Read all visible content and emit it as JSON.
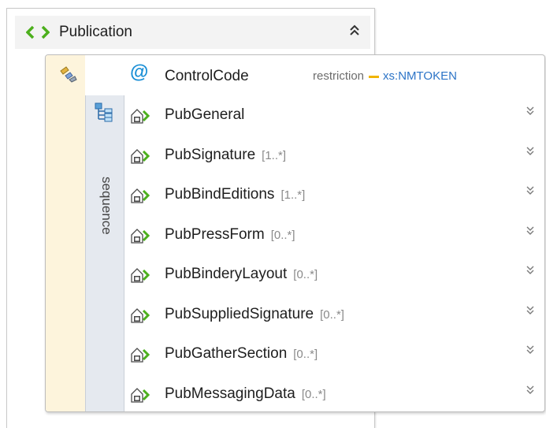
{
  "element": {
    "name": "Publication"
  },
  "attribute": {
    "name": "ControlCode",
    "restriction_label": "restriction",
    "type": "xs:NMTOKEN"
  },
  "sequence_label": "sequence",
  "children": [
    {
      "name": "PubGeneral",
      "multiplicity": ""
    },
    {
      "name": "PubSignature",
      "multiplicity": "[1..*]"
    },
    {
      "name": "PubBindEditions",
      "multiplicity": "[1..*]"
    },
    {
      "name": "PubPressForm",
      "multiplicity": "[0..*]"
    },
    {
      "name": "PubBinderyLayout",
      "multiplicity": "[0..*]"
    },
    {
      "name": "PubSuppliedSignature",
      "multiplicity": "[0..*]"
    },
    {
      "name": "PubGatherSection",
      "multiplicity": "[0..*]"
    },
    {
      "name": "PubMessagingData",
      "multiplicity": "[0..*]"
    }
  ],
  "icons": {
    "element": "element-brackets-icon",
    "choice": "choice-icon",
    "sequence": "sequence-tree-icon",
    "child": "child-element-icon",
    "collapse": "collapse-chevron-icon",
    "expand": "expand-chevron-icon"
  },
  "colors": {
    "element_green": "#4caf1c",
    "attribute_blue": "#1a8fd6",
    "type_blue": "#2c74c7",
    "restriction_dash": "#f0b400",
    "choice_bg": "#fdf4dc",
    "sequence_bg": "#e5e9ef"
  }
}
